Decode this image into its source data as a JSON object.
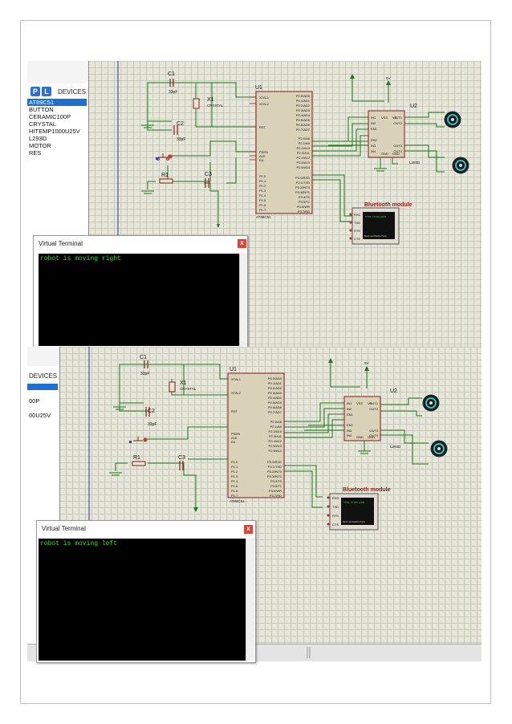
{
  "sidebar": {
    "p_btn": "P",
    "l_btn": "L",
    "devices_label": "DEVICES",
    "devices": [
      "AT89C51",
      "BUTTON",
      "CERAMIC100P",
      "CRYSTAL",
      "HITEMP1000U25V",
      "L293D",
      "MOTOR",
      "RES"
    ],
    "devices_crop": [
      "00P",
      "00U25V"
    ]
  },
  "schematic": {
    "c1": "C1",
    "c1_val": "33pF",
    "c2": "C2",
    "c2_val": "33pF",
    "c3": "C3",
    "x1": "X1",
    "x1_val": "CRYSTAL",
    "r1": "R1",
    "u1": "U1",
    "u1_part": "AT89C51",
    "u2": "U2",
    "u2_part": "L293D",
    "u1_pins_left": [
      "XTAL1",
      "XTAL2",
      "RST",
      "PSEN",
      "ALE",
      "EA",
      "P1.0",
      "P1.1",
      "P1.2",
      "P1.3",
      "P1.4",
      "P1.5",
      "P1.6",
      "P1.7"
    ],
    "u1_pins_right_a": [
      "P0.0/AD0",
      "P0.1/AD1",
      "P0.2/AD2",
      "P0.3/AD3",
      "P0.4/AD4",
      "P0.5/AD5",
      "P0.6/AD6",
      "P0.7/AD7"
    ],
    "u1_pins_right_b": [
      "P2.0/A8",
      "P2.1/A9",
      "P2.2/A10",
      "P2.3/A11",
      "P2.4/A12",
      "P2.5/A13",
      "P2.6/A14",
      "P2.7/A15"
    ],
    "u1_pins_right_c": [
      "P3.0/RXD",
      "P3.1/TXD",
      "P3.2/INT0",
      "P3.3/INT1",
      "P3.4/T0",
      "P3.5/T1",
      "P3.6/WR",
      "P3.7/RD"
    ],
    "u2_pins_left": [
      "IN1",
      "IN2",
      "EN1",
      "EN2",
      "IN3",
      "IN4"
    ],
    "u2_pins_top": [
      "VSS",
      "VS"
    ],
    "u2_pins_right": [
      "OUT1",
      "OUT2",
      "OUT3",
      "OUT4"
    ],
    "u2_pins_bottom": [
      "GND",
      "GND"
    ],
    "bt_title": "Bluetooth module",
    "bt_pins": [
      "RXD",
      "TXD",
      "RTS",
      "CTS"
    ],
    "bt_screen_top": "VT52, VT100, ANSI",
    "bt_screen_bottom": "Baud rate  Databits  Parity",
    "vcc": "5V"
  },
  "terminal_top": {
    "title": "Virtual Terminal",
    "close": "x",
    "text": "robot is moving right"
  },
  "terminal_bottom": {
    "title": "Virtual Terminal",
    "close": "x",
    "text": "robot is moving left"
  },
  "colors": {
    "grid_bg": "#e6e6da",
    "wire": "#1a7a1a",
    "component": "#8b1a1a",
    "chip_fill": "#d9d1b8",
    "terminal_text": "#34e02c",
    "selection": "#1f6fd1",
    "probe_red": "#c0392b",
    "probe_blue": "#2240c0"
  }
}
